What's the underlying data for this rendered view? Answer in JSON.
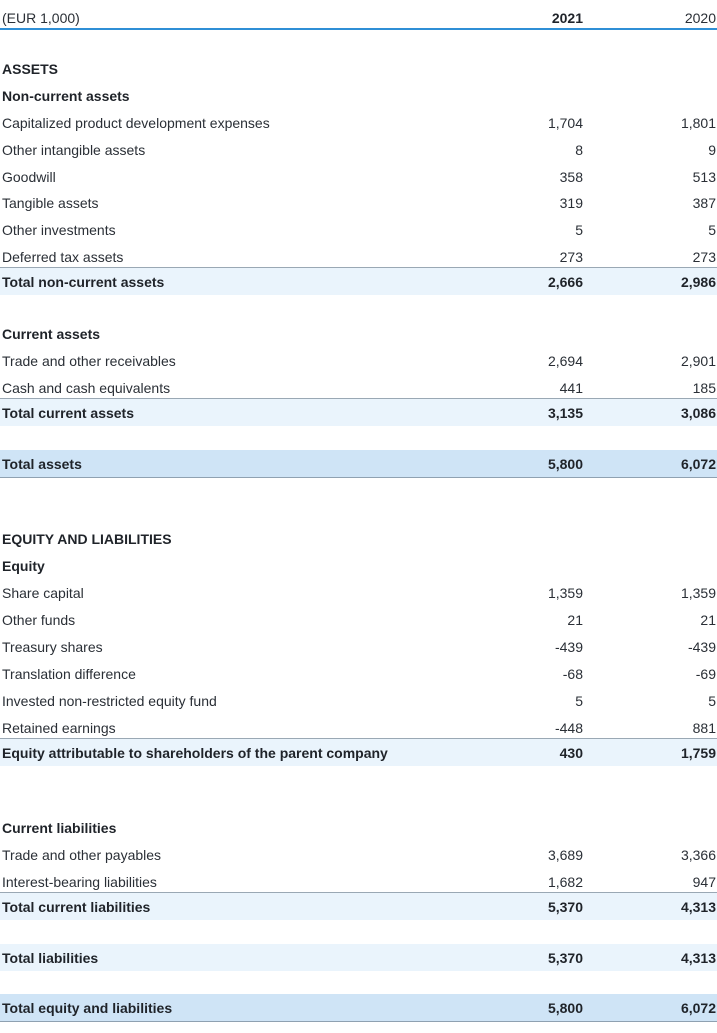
{
  "header": {
    "unit": "(EUR 1,000)",
    "col1": "2021",
    "col2": "2020"
  },
  "assets": {
    "title": "ASSETS",
    "noncurrent": {
      "title": "Non-current assets",
      "rows": [
        {
          "label": "Capitalized product development expenses",
          "v1": "1,704",
          "v2": "1,801"
        },
        {
          "label": "Other intangible assets",
          "v1": "8",
          "v2": "9"
        },
        {
          "label": "Goodwill",
          "v1": "358",
          "v2": "513"
        },
        {
          "label": "Tangible assets",
          "v1": "319",
          "v2": "387"
        },
        {
          "label": "Other investments",
          "v1": "5",
          "v2": "5"
        },
        {
          "label": "Deferred tax assets",
          "v1": "273",
          "v2": "273"
        }
      ],
      "total": {
        "label": "Total non-current assets",
        "v1": "2,666",
        "v2": "2,986"
      }
    },
    "current": {
      "title": "Current assets",
      "rows": [
        {
          "label": "Trade and other receivables",
          "v1": "2,694",
          "v2": "2,901"
        },
        {
          "label": "Cash and cash equivalents",
          "v1": "441",
          "v2": "185"
        }
      ],
      "total": {
        "label": "Total current assets",
        "v1": "3,135",
        "v2": "3,086"
      }
    },
    "total": {
      "label": "Total assets",
      "v1": "5,800",
      "v2": "6,072"
    }
  },
  "equity_liabilities": {
    "title": "EQUITY AND LIABILITIES",
    "equity": {
      "title": "Equity",
      "rows": [
        {
          "label": "Share capital",
          "v1": "1,359",
          "v2": "1,359"
        },
        {
          "label": "Other funds",
          "v1": "21",
          "v2": "21"
        },
        {
          "label": "Treasury shares",
          "v1": "-439",
          "v2": "-439"
        },
        {
          "label": "Translation difference",
          "v1": "-68",
          "v2": "-69"
        },
        {
          "label": "Invested non-restricted equity fund",
          "v1": "5",
          "v2": "5"
        },
        {
          "label": "Retained earnings",
          "v1": "-448",
          "v2": "881"
        }
      ],
      "total": {
        "label": "Equity attributable to shareholders of the parent company",
        "v1": "430",
        "v2": "1,759"
      }
    },
    "current_liabilities": {
      "title": "Current liabilities",
      "rows": [
        {
          "label": "Trade and other payables",
          "v1": "3,689",
          "v2": "3,366"
        },
        {
          "label": "Interest-bearing liabilities",
          "v1": "1,682",
          "v2": "947"
        }
      ],
      "total": {
        "label": "Total current liabilities",
        "v1": "5,370",
        "v2": "4,313"
      }
    },
    "total_liabilities": {
      "label": "Total liabilities",
      "v1": "5,370",
      "v2": "4,313"
    },
    "total": {
      "label": "Total equity and liabilities",
      "v1": "5,800",
      "v2": "6,072"
    }
  }
}
